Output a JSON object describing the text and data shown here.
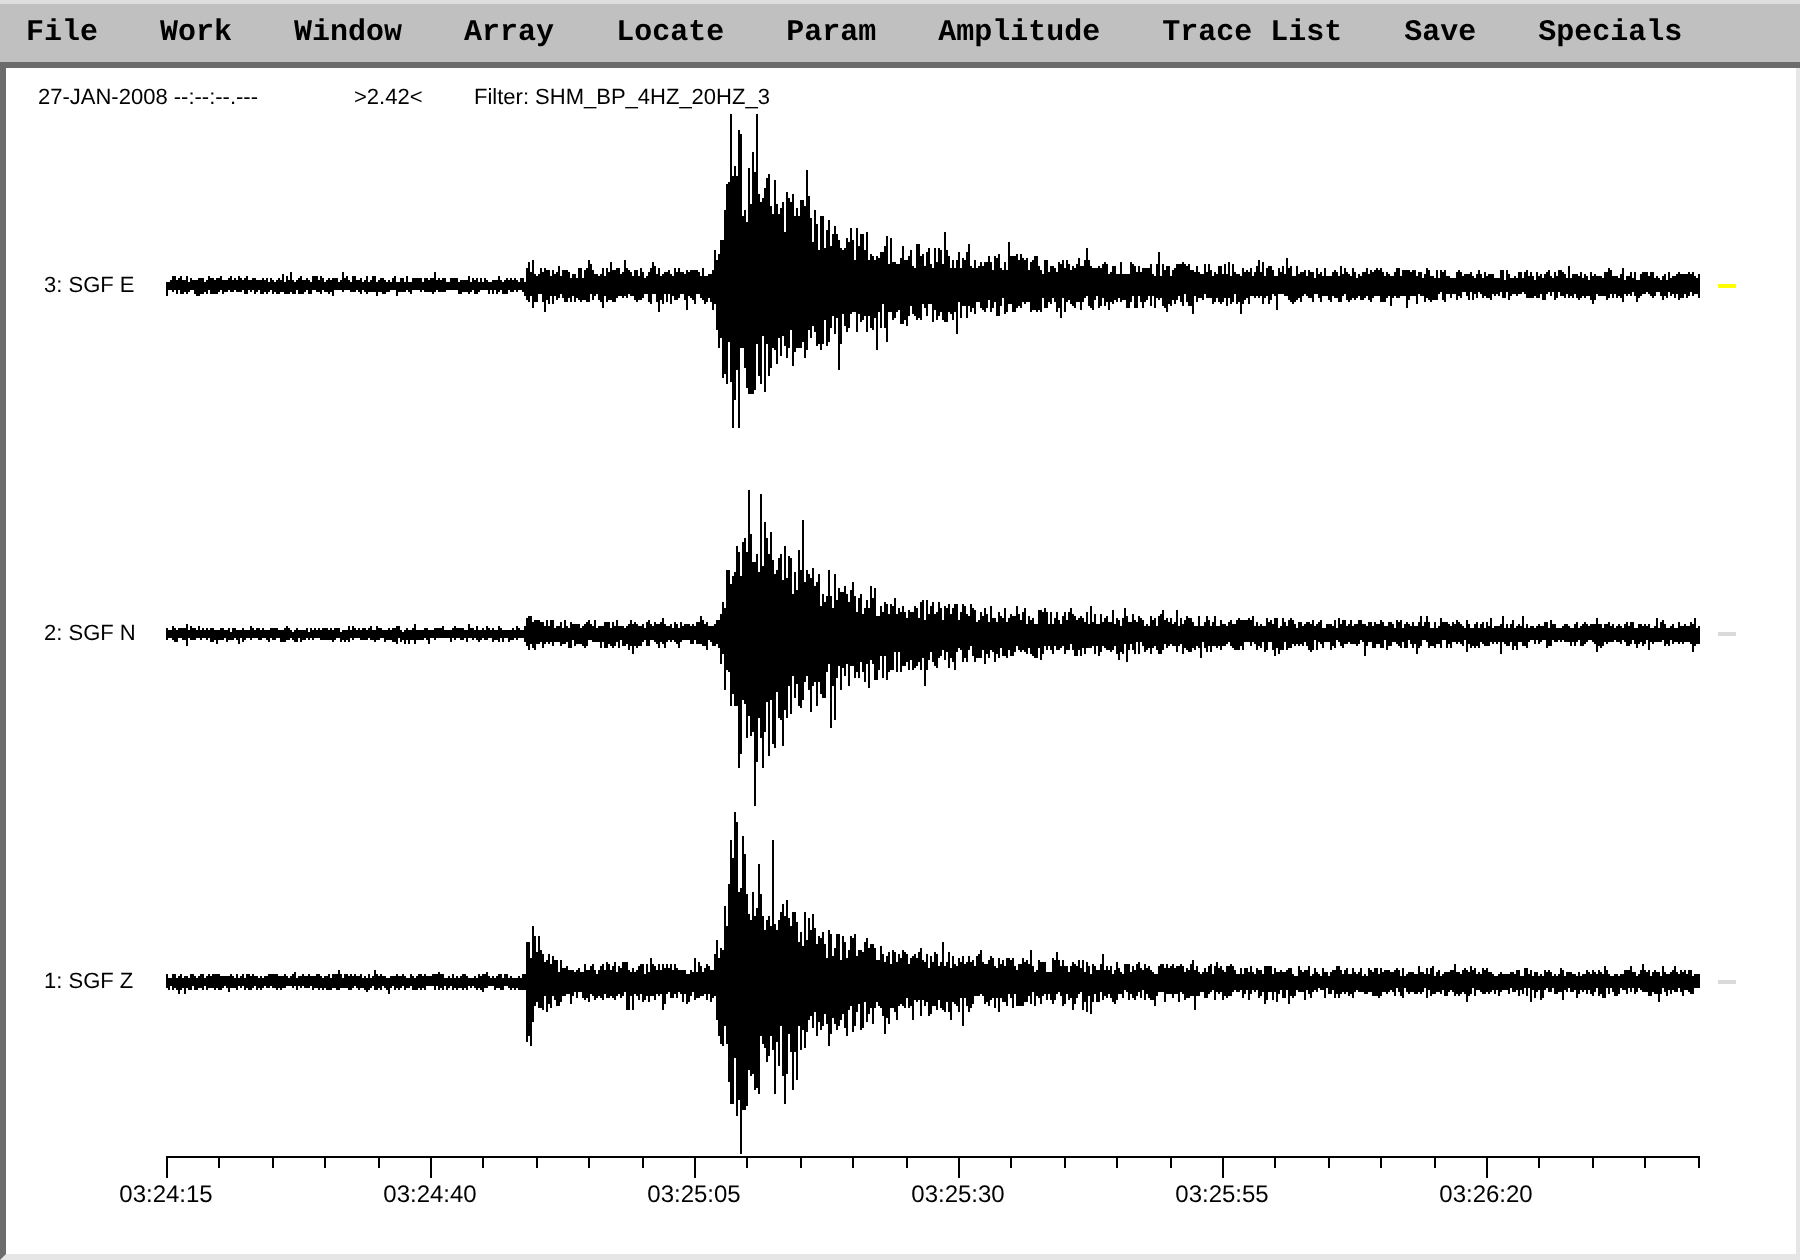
{
  "menu_bar": [
    "File",
    "Work",
    "Window",
    "Array",
    "Locate",
    "Param",
    "Amplitude",
    "Trace List",
    "Save",
    "Specials"
  ],
  "header": {
    "date_time": "27-JAN-2008 --:--:--.---",
    "readout": ">2.42<",
    "filter": "Filter: SHM_BP_4HZ_20HZ_3"
  },
  "traces": [
    {
      "label": "3: SGF E",
      "selected": true
    },
    {
      "label": "2: SGF N",
      "selected": false
    },
    {
      "label": "1: SGF Z",
      "selected": false
    }
  ],
  "time_axis": {
    "labels": [
      "03:24:15",
      "03:24:40",
      "03:25:05",
      "03:25:30",
      "03:25:55",
      "03:26:20"
    ]
  }
}
